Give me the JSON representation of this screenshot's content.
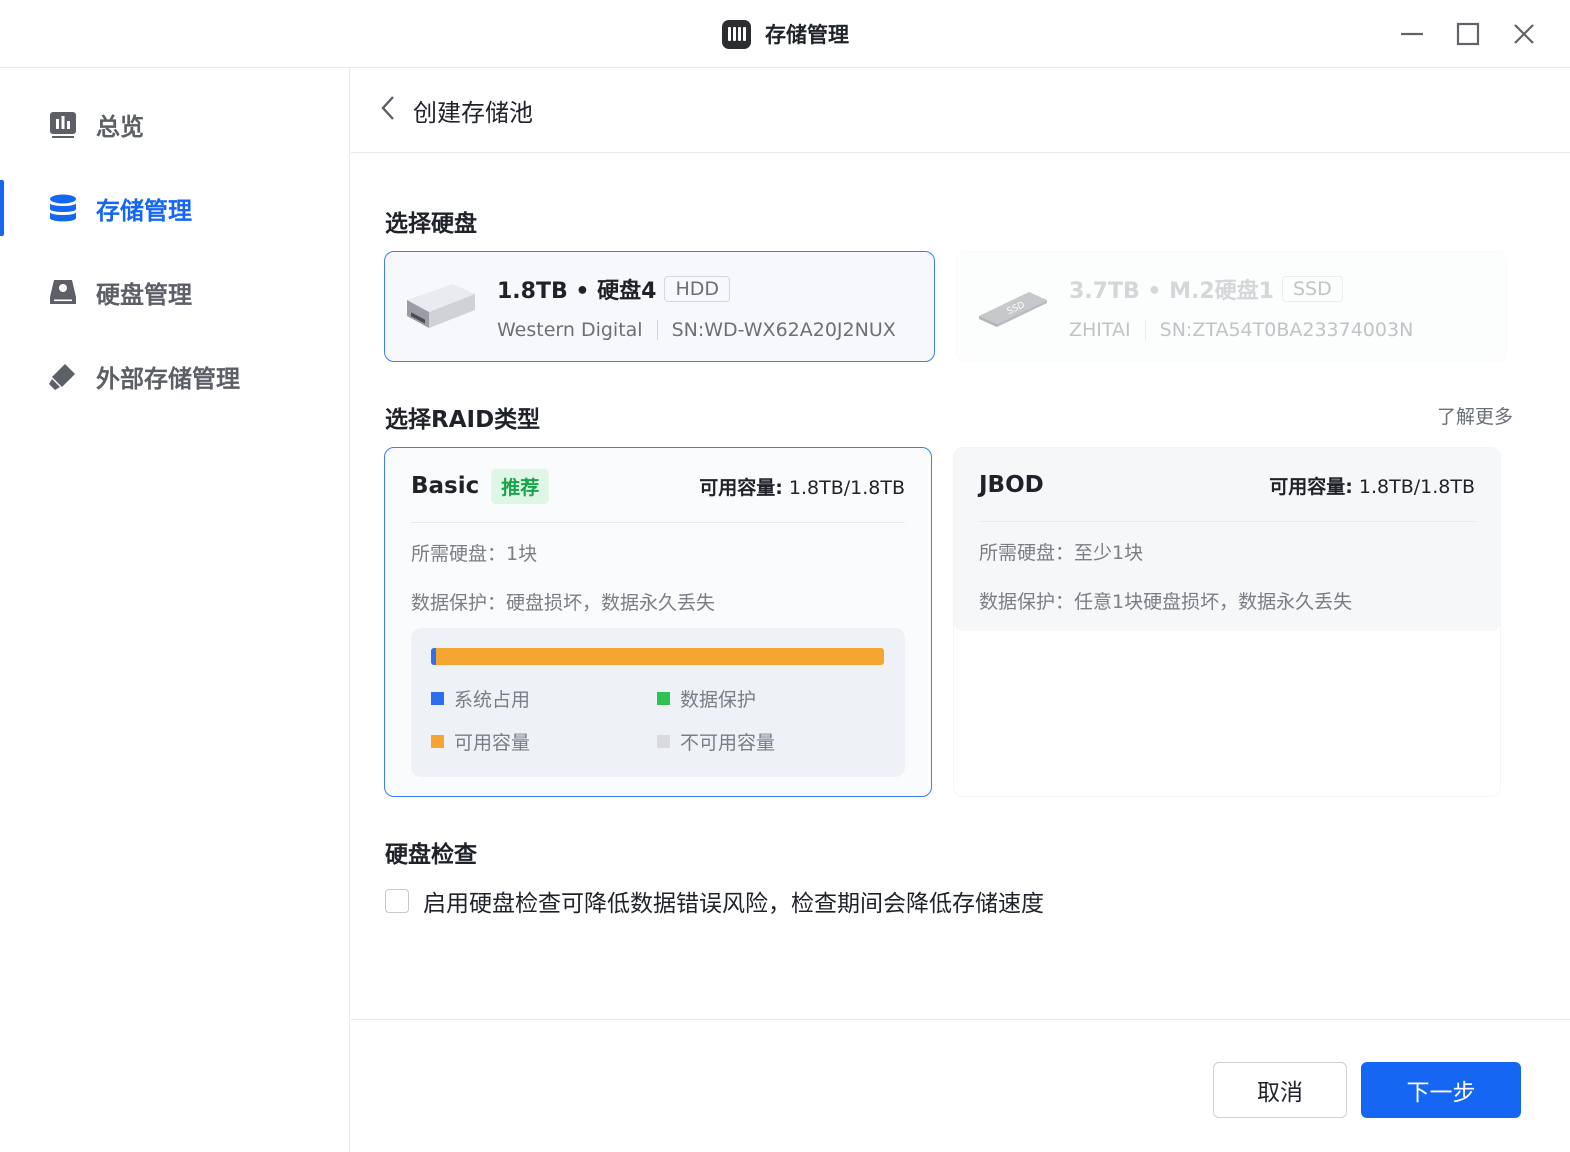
{
  "window": {
    "title": "存储管理",
    "app_icon": "storage-app-icon",
    "controls": [
      "minimize-icon",
      "maximize-icon",
      "close-icon"
    ]
  },
  "sidebar": {
    "items": [
      {
        "label": "总览",
        "icon": "chart-icon",
        "active": false
      },
      {
        "label": "存储管理",
        "icon": "database-icon",
        "active": true
      },
      {
        "label": "硬盘管理",
        "icon": "disk-icon",
        "active": false
      },
      {
        "label": "外部存储管理",
        "icon": "usb-icon",
        "active": false
      }
    ]
  },
  "header": {
    "title": "创建存储池",
    "back_icon": "chevron-left-icon"
  },
  "select_disk": {
    "title": "选择硬盘",
    "disks": [
      {
        "name": "1.8TB • 硬盘4",
        "type": "HDD",
        "vendor": "Western Digital",
        "serial": "SN:WD-WX62A20J2NUX",
        "selected": true,
        "disabled": false
      },
      {
        "name": "3.7TB • M.2硬盘1",
        "type": "SSD",
        "vendor": "ZHITAI",
        "serial": "SN:ZTA54T0BA23374003N",
        "selected": false,
        "disabled": true
      }
    ]
  },
  "select_raid": {
    "title": "选择RAID类型",
    "learn_more": "了解更多",
    "options": [
      {
        "name": "Basic",
        "tag": "推荐",
        "capacity_label": "可用容量:",
        "capacity_value": "1.8TB/1.8TB",
        "required": "所需硬盘：1块",
        "protection": "数据保护：硬盘损坏，数据永久丢失",
        "selected": true
      },
      {
        "name": "JBOD",
        "capacity_label": "可用容量:",
        "capacity_value": "1.8TB/1.8TB",
        "required": "所需硬盘：至少1块",
        "protection": "数据保护：任意1块硬盘损坏，数据永久丢失",
        "selected": false
      }
    ],
    "usage": {
      "system_fraction": 0.01,
      "protection_fraction": 0,
      "available_fraction": 0.99,
      "unavailable_fraction": 0,
      "legend": [
        {
          "label": "系统占用",
          "color": "#2f6fed"
        },
        {
          "label": "数据保护",
          "color": "#2fc253"
        },
        {
          "label": "可用容量",
          "color": "#f6a530"
        },
        {
          "label": "不可用容量",
          "color": "#d8dadd"
        }
      ]
    }
  },
  "disk_check": {
    "title": "硬盘检查",
    "checkbox_label": "启用硬盘检查可降低数据错误风险，检查期间会降低存储速度",
    "checked": false
  },
  "footer": {
    "cancel": "取消",
    "next": "下一步"
  },
  "colors": {
    "accent": "#1566f2",
    "success": "#1aa34a"
  }
}
